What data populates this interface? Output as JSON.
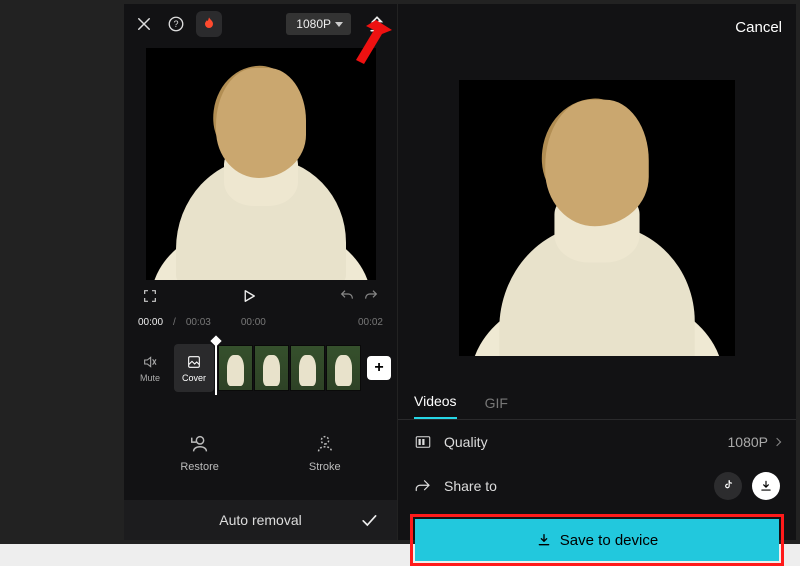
{
  "left": {
    "resolution": "1080P",
    "time": {
      "current": "00:00",
      "total": "00:03",
      "marks": [
        "00:00",
        "00:02"
      ]
    },
    "track_tools": {
      "mute": "Mute",
      "cover": "Cover"
    },
    "actions": {
      "restore": "Restore",
      "stroke": "Stroke"
    },
    "bottom": {
      "label": "Auto removal"
    }
  },
  "right": {
    "cancel": "Cancel",
    "tabs": {
      "videos": "Videos",
      "gif": "GIF"
    },
    "quality": {
      "label": "Quality",
      "value": "1080P"
    },
    "share": {
      "label": "Share to"
    },
    "save": {
      "label": "Save to device"
    }
  }
}
